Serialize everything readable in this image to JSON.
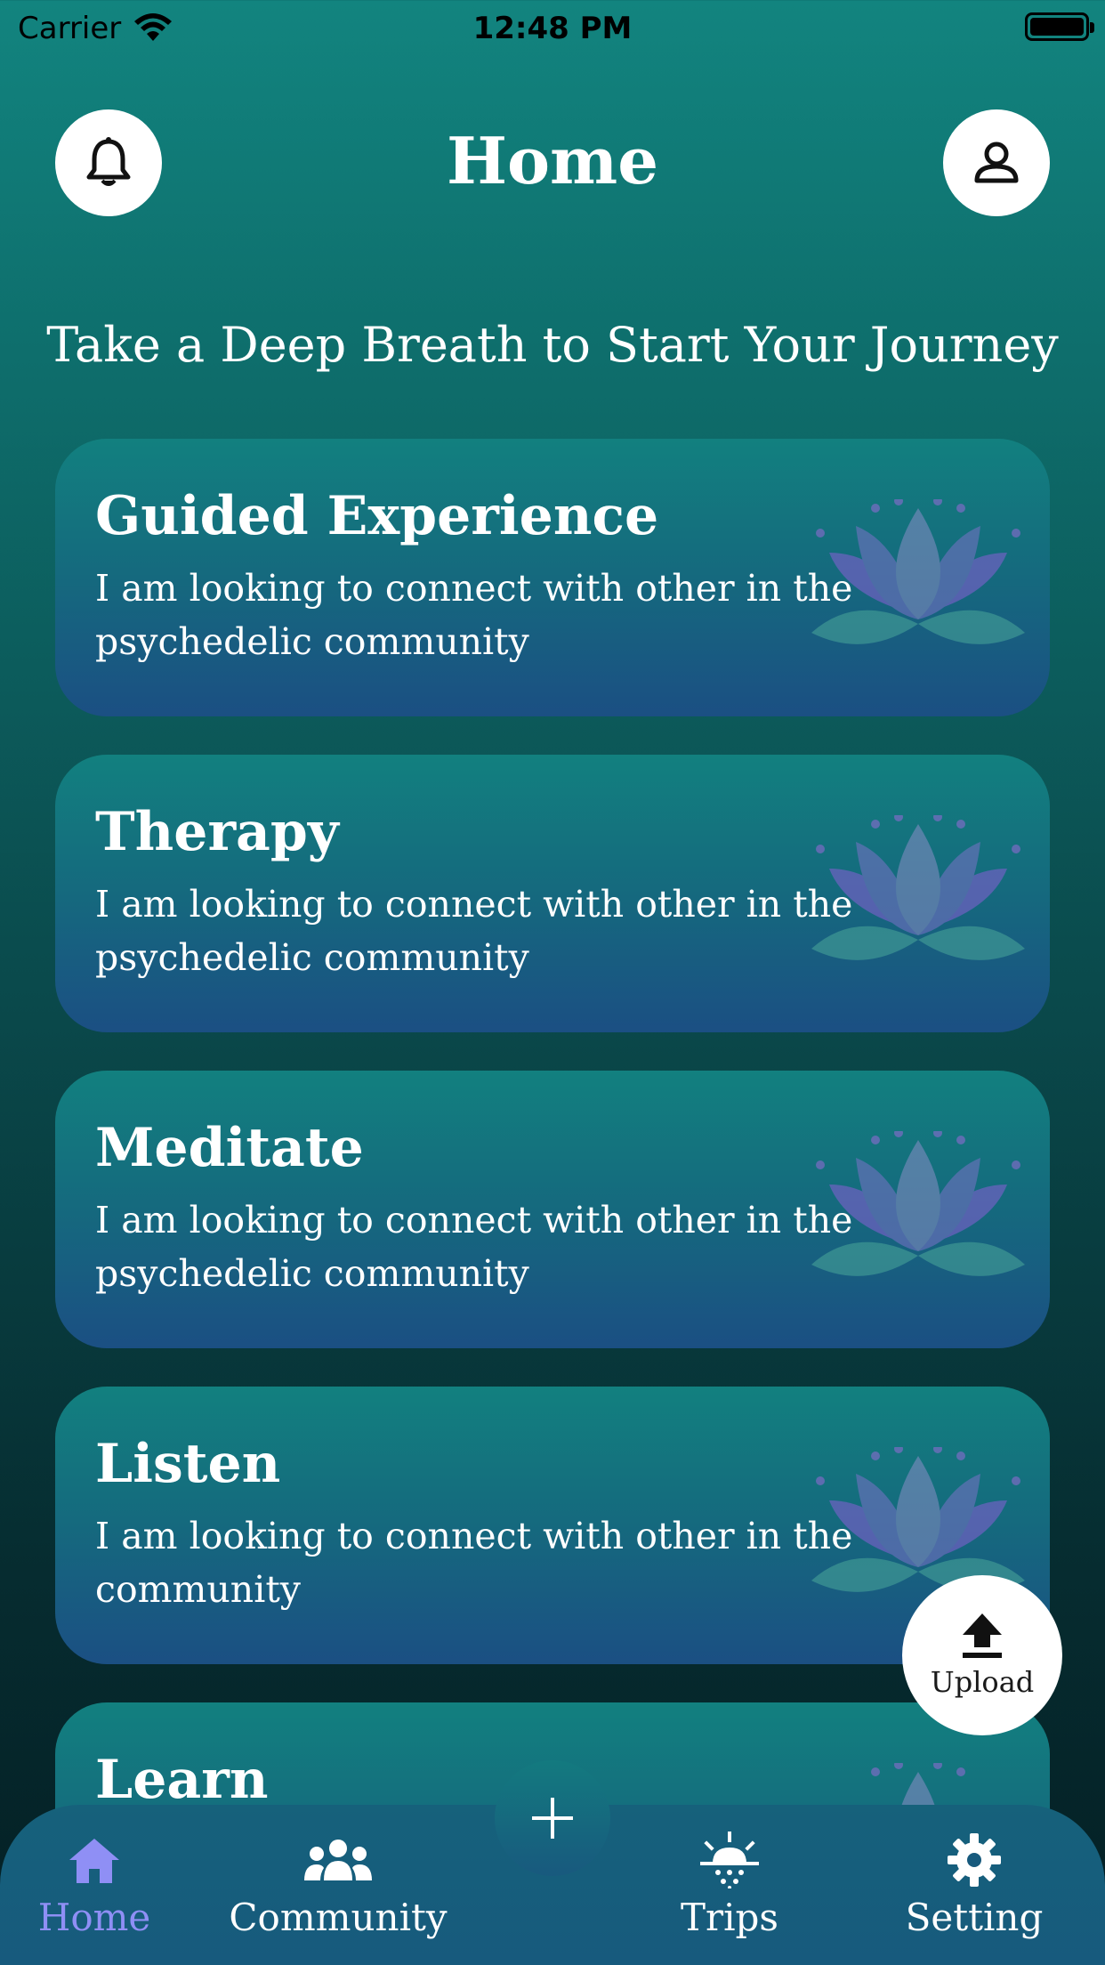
{
  "status_bar": {
    "carrier": "Carrier",
    "time": "12:48 PM"
  },
  "header": {
    "title": "Home",
    "notification_icon": "bell-icon",
    "profile_icon": "user-icon"
  },
  "subtitle": "Take a Deep Breath to Start Your Journey",
  "cards": [
    {
      "title": "Guided Experience",
      "description": "I am looking to connect with other in the psychedelic community",
      "icon": "lotus-icon"
    },
    {
      "title": "Therapy",
      "description": "I am looking to connect with other in the psychedelic community",
      "icon": "lotus-icon"
    },
    {
      "title": "Meditate",
      "description": "I am looking to connect with other in the psychedelic community",
      "icon": "lotus-icon"
    },
    {
      "title": "Listen",
      "description": "I am looking to connect with other in the community",
      "icon": "lotus-icon"
    },
    {
      "title": "Learn",
      "description": "",
      "icon": "lotus-icon"
    }
  ],
  "upload_button": {
    "label": "Upload",
    "icon": "upload-icon"
  },
  "tab_bar": {
    "items": [
      {
        "label": "Home",
        "icon": "home-icon",
        "active": true
      },
      {
        "label": "Community",
        "icon": "community-icon",
        "active": false
      },
      {
        "label": "Trips",
        "icon": "sunrise-icon",
        "active": false
      },
      {
        "label": "Setting",
        "icon": "gear-icon",
        "active": false
      }
    ],
    "center_action_icon": "plus-icon"
  },
  "colors": {
    "active_tab": "#8f8ff5",
    "background_top": "#12847f",
    "background_bottom": "#041f24",
    "card_top": "#12807f",
    "card_bottom": "#1b4f83"
  }
}
